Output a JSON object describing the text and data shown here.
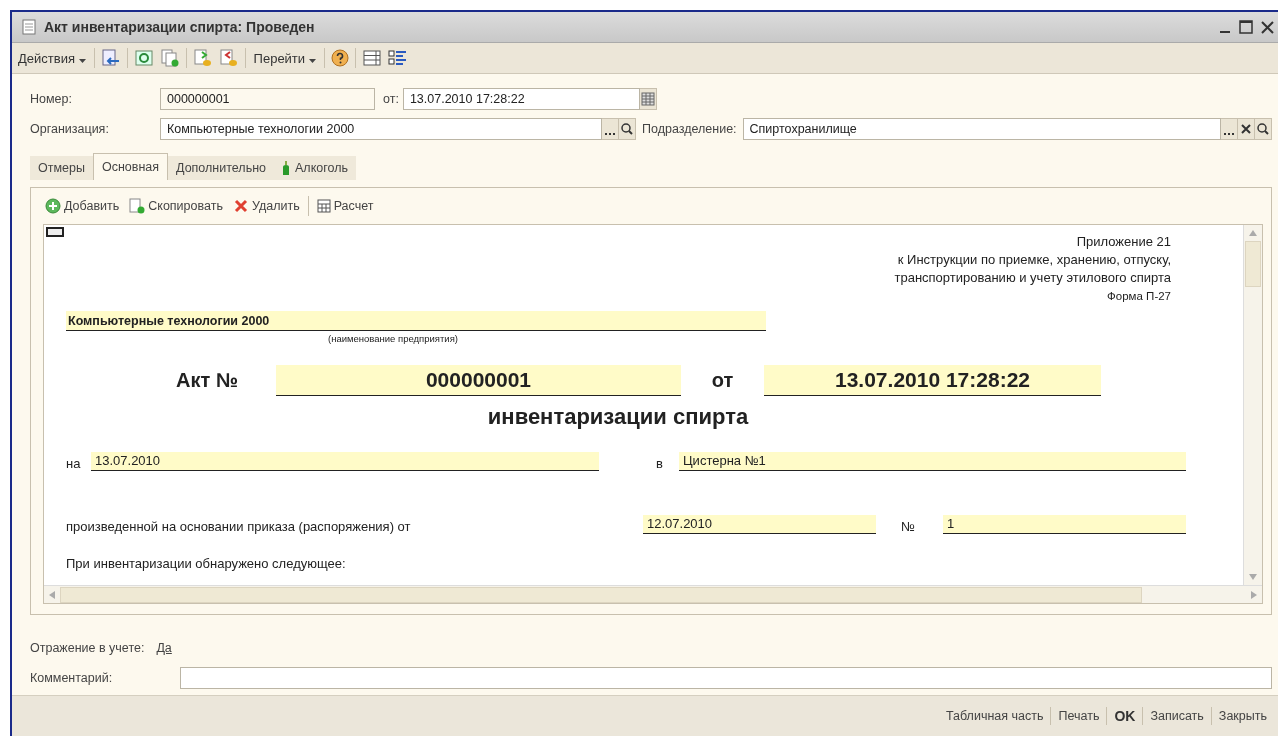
{
  "window": {
    "title": "Акт инвентаризации спирта: Проведен"
  },
  "toolbar": {
    "actions_menu": "Действия",
    "goto_menu": "Перейти"
  },
  "header": {
    "number_label": "Номер:",
    "number": "000000001",
    "date_label": "от:",
    "date": "13.07.2010 17:28:22",
    "organization_label": "Организация:",
    "organization": "Компьютерные технологии 2000",
    "department_label": "Подразделение:",
    "department": "Спиртохранилище"
  },
  "tabs": [
    {
      "label": "Отмеры",
      "selected": false,
      "kind": "plain"
    },
    {
      "label": "Основная",
      "selected": true,
      "kind": "plain"
    },
    {
      "label": "Дополнительно",
      "selected": false,
      "kind": "plain"
    },
    {
      "label": "Алкоголь",
      "selected": false,
      "kind": "bottle"
    }
  ],
  "tab_toolbar": [
    {
      "label": "Добавить",
      "kind": "add"
    },
    {
      "label": "Скопировать",
      "kind": "copy"
    },
    {
      "label": "Удалить",
      "kind": "delete"
    },
    {
      "label": "Расчет",
      "kind": "calc"
    }
  ],
  "document": {
    "appendix": [
      "Приложение 21",
      "к Инструкции по приемке, хранению, отпуску,",
      "транспортированию и учету этилового спирта",
      "Форма П-27"
    ],
    "enterprise": "Компьютерные технологии 2000",
    "enterprise_caption": "(наименование предприятия)",
    "act_label": "Акт №",
    "act_number": "000000001",
    "act_date_label": "от",
    "act_date": "13.07.2010 17:28:22",
    "title": "инвентаризации спирта",
    "on_label": "на",
    "on_date": "13.07.2010",
    "in_label": "в",
    "in_place": "Цистерна №1",
    "order_text": "произведенной на основании приказа (распоряжения) от",
    "order_date": "12.07.2010",
    "order_no_label": "№",
    "order_no": "1",
    "found_text": "При инвентаризации обнаружено следующее:"
  },
  "accounting": {
    "label": "Отражение в учете:",
    "link": "Да"
  },
  "comment": {
    "label": "Комментарий:"
  },
  "footer_buttons": [
    {
      "label": "Табличная часть",
      "default": false
    },
    {
      "label": "Печать",
      "default": false
    },
    {
      "label": "OK",
      "default": true
    },
    {
      "label": "Записать",
      "default": false
    },
    {
      "label": "Закрыть",
      "default": false
    }
  ]
}
